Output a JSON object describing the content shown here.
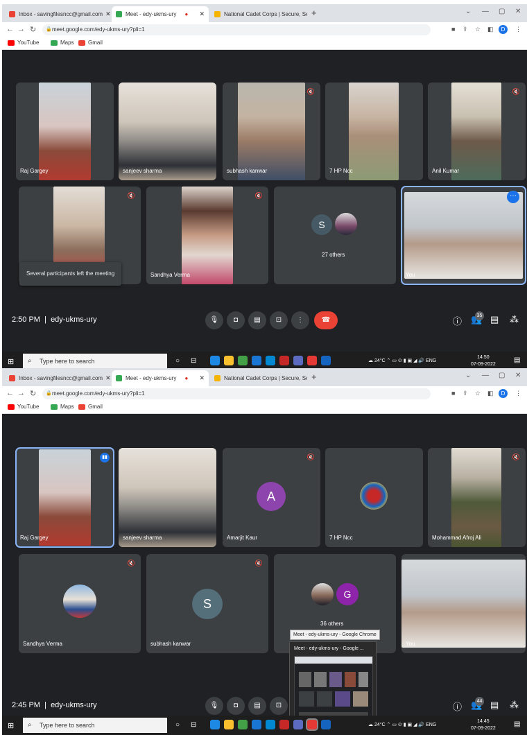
{
  "browser": {
    "tabs": [
      {
        "label": "Inbox - savingfilesncc@gmail.com",
        "color": "#ea4335"
      },
      {
        "label": "Meet - edy-ukms-ury",
        "color": "#34a853"
      },
      {
        "label": "National Cadet Corps | Secure, Se",
        "color": "#f4b400"
      }
    ],
    "url": "meet.google.com/edy-ukms-ury?pli=1",
    "profile_letter": "D",
    "bookmarks": [
      "YouTube",
      "Maps",
      "Gmail"
    ]
  },
  "taskbar": {
    "search_placeholder": "Type here to search",
    "weather": "24°C",
    "lang": "ENG",
    "date": "07-09-2022"
  },
  "screenshot1": {
    "time": "2:50 PM",
    "meeting_code": "edy-ukms-ury",
    "participants_count": "35",
    "clock": "14:50",
    "toast": "Several participants left the meeting",
    "others_label": "27 others",
    "others_avatar": "S",
    "names": [
      "Raj Gargey",
      "sanjeev sharma",
      "subhash kanwar",
      "7 HP Ncc",
      "Anil Kumar",
      "Sandhya Verma",
      "You"
    ]
  },
  "screenshot2": {
    "time": "2:45 PM",
    "meeting_code": "edy-ukms-ury",
    "participants_count": "44",
    "clock": "14:45",
    "others_label": "36 others",
    "others_avatar": "G",
    "avatar_amarjit": "A",
    "avatar_subhash": "S",
    "names": [
      "Raj Gargey",
      "sanjeev sharma",
      "Amarjit Kaur",
      "7 HP Ncc",
      "Mohammad Afroj Ali",
      "Sandhya Verma",
      "subhash kanwar",
      "You"
    ],
    "popup_tooltip": "Meet - edy-ukms-ury - Google Chrome",
    "popup_title": "Meet - edy-ukms-ury - Google ..."
  },
  "colors": {
    "meet_bg": "#202124",
    "tile_bg": "#3c4043",
    "hangup": "#ea4335",
    "active_outline": "#8ab4f8"
  }
}
